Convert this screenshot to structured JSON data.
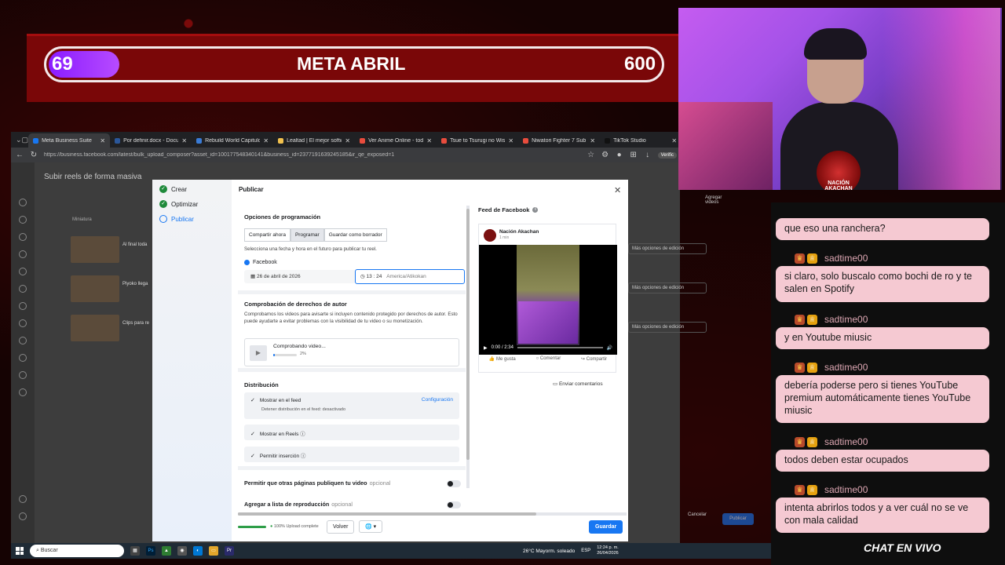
{
  "goal": {
    "title": "META ABRIL",
    "current": "69",
    "target": "600",
    "progress": 0.115
  },
  "browser": {
    "tabs": [
      {
        "label": "Meta Business Suite",
        "color": "#1877f2",
        "active": true
      },
      {
        "label": "Por definir.docx - Documen",
        "color": "#2b579a"
      },
      {
        "label": "Rebuild World Capitulo 48",
        "color": "#3a7bd5"
      },
      {
        "label": "Lealtad | El mejor software",
        "color": "#f2c14e"
      },
      {
        "label": "Ver Anime Online - todos lo",
        "color": "#e84c3d"
      },
      {
        "label": "Tsue to Tsurugi no Wistoria",
        "color": "#e84c3d"
      },
      {
        "label": "Niwatori Fighter 7 Sub Espa",
        "color": "#e84c3d"
      },
      {
        "label": "TikTok Studio",
        "color": "#111111"
      }
    ],
    "url": "https://business.facebook.com/latest/bulk_upload_composer?asset_id=100177548340141&business_id=2377191639245185&ir_qe_exposed=1",
    "verif_label": "Verific"
  },
  "page": {
    "title": "Subir reels de forma masiva",
    "column_thumbnail": "Miniatura",
    "add_videos": "Agregar videos",
    "rows": [
      {
        "name": "Al final toda",
        "more": "Más opciones de edición"
      },
      {
        "name": "Piyoko llega",
        "more": "Más opciones de edición"
      },
      {
        "name": "Clips para re",
        "more": "Más opciones de edición"
      }
    ],
    "cancel": "Cancelar",
    "publish": "Publicar"
  },
  "modal": {
    "title": "Publicar",
    "steps": [
      {
        "label": "Crear",
        "state": "done"
      },
      {
        "label": "Optimizar",
        "state": "done"
      },
      {
        "label": "Publicar",
        "state": "current"
      }
    ],
    "schedule": {
      "heading": "Opciones de programación",
      "options": [
        "Compartir ahora",
        "Programar",
        "Guardar como borrador"
      ],
      "selected": "Programar",
      "hint": "Selecciona una fecha y hora en el futuro para publicar tu reel.",
      "platform": "Facebook",
      "date": "26 de abril de 2026",
      "time": "13 : 24",
      "timezone": "America/Atikokan"
    },
    "rights": {
      "heading": "Comprobación de derechos de autor",
      "body": "Comprobamos los videos para avisarte si incluyen contenido protegido por derechos de autor. Esto puede ayudarte a evitar problemas con la visibilidad de tu video o su monetización.",
      "status": "Comprobando video...",
      "percent": "2%",
      "progress": 0.02
    },
    "distribution": {
      "heading": "Distribución",
      "items": [
        {
          "label": "Mostrar en el feed",
          "link": "Configuración",
          "sub": "Detener distribución en el feed: desactivado",
          "checked": true
        },
        {
          "label": "Mostrar en Reels",
          "checked": true
        },
        {
          "label": "Permitir inserción",
          "checked": true
        }
      ]
    },
    "toggles": [
      {
        "label": "Permitir que otras páginas publiquen tu video",
        "optional": "opcional"
      },
      {
        "label": "Agregar a lista de reproducción",
        "optional": "opcional"
      }
    ],
    "preview": {
      "title": "Feed de Facebook",
      "page_name": "Nación Akachan",
      "page_sub": "1 min",
      "video_time": "0:00 / 2:34",
      "actions": [
        "Me gusta",
        "Comentar",
        "Compartir"
      ],
      "feedback": "Enviar comentarios"
    },
    "footer": {
      "upload_status": "100% Upload complete",
      "back": "Volver",
      "save": "Guardar"
    }
  },
  "webcam": {
    "logo_text": "NACIÓN AKACHAN"
  },
  "chat": {
    "label": "CHAT EN VIVO",
    "messages": [
      {
        "text": "que eso una ranchera?"
      },
      {
        "user": "sadtime00",
        "text": "si claro, solo buscalo como bochi de ro y te salen en Spotify"
      },
      {
        "user": "sadtime00",
        "text": "y en Youtube miusic"
      },
      {
        "user": "sadtime00",
        "text": "debería poderse pero si tienes YouTube premium automáticamente tienes YouTube miusic"
      },
      {
        "user": "sadtime00",
        "text": "todos deben estar ocupados"
      },
      {
        "user": "sadtime00",
        "text": "intenta abrirlos todos y a ver cuál no se ve con mala calidad"
      }
    ]
  },
  "taskbar": {
    "search": "Buscar",
    "weather": "26°C  Mayorm. soleado",
    "lang": "ESP",
    "time": "12:24 p. m.",
    "date": "26/04/2026"
  }
}
